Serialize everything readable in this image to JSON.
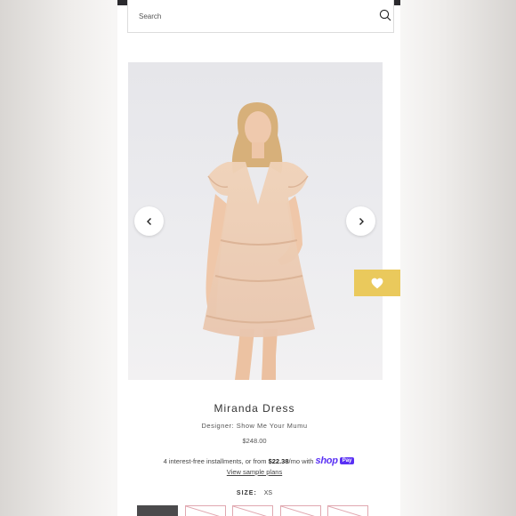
{
  "search": {
    "placeholder": "Search"
  },
  "product": {
    "title": "Miranda Dress",
    "designer": "Designer: Show Me Your Mumu",
    "price": "$248.00"
  },
  "installments": {
    "prefix": "4 interest-free installments, or from",
    "amount": "$22.38",
    "suffix": "/mo with",
    "shop_label": "shop",
    "pay_label": "Pay",
    "link": "View sample plans"
  },
  "size": {
    "label": "SIZE:",
    "value": "XS",
    "selected_index": 0
  },
  "colors": {
    "wishlist": "#eac95c",
    "shop_pay": "#5a31f4"
  }
}
